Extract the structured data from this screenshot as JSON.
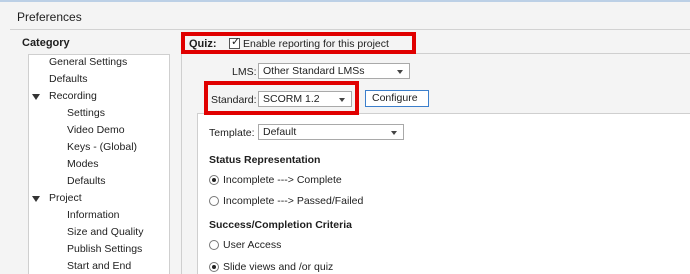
{
  "window": {
    "title": "Preferences"
  },
  "category": {
    "heading": "Category",
    "items": [
      {
        "label": "General Settings"
      },
      {
        "label": "Defaults"
      },
      {
        "label": "Recording"
      },
      {
        "label": "Settings"
      },
      {
        "label": "Video Demo"
      },
      {
        "label": "Keys - (Global)"
      },
      {
        "label": "Modes"
      },
      {
        "label": "Defaults"
      },
      {
        "label": "Project"
      },
      {
        "label": "Information"
      },
      {
        "label": "Size and Quality"
      },
      {
        "label": "Publish Settings"
      },
      {
        "label": "Start and End"
      }
    ]
  },
  "quiz": {
    "label": "Quiz:",
    "reporting_label": "Enable reporting for this project",
    "reporting_checked": true
  },
  "lms": {
    "label": "LMS:",
    "value": "Other Standard LMSs"
  },
  "standard": {
    "label": "Standard:",
    "value": "SCORM 1.2",
    "configure_label": "Configure"
  },
  "template": {
    "label": "Template:",
    "value": "Default"
  },
  "status_representation": {
    "heading": "Status Representation",
    "options": [
      {
        "label": "Incomplete ---> Complete",
        "selected": true
      },
      {
        "label": "Incomplete ---> Passed/Failed",
        "selected": false
      }
    ]
  },
  "success_criteria": {
    "heading": "Success/Completion Criteria",
    "options": [
      {
        "label": "User Access",
        "selected": false
      },
      {
        "label": "Slide views and /or quiz",
        "selected": true
      }
    ]
  },
  "colors": {
    "highlight": "#e00000",
    "button_border": "#3c7fcc"
  }
}
